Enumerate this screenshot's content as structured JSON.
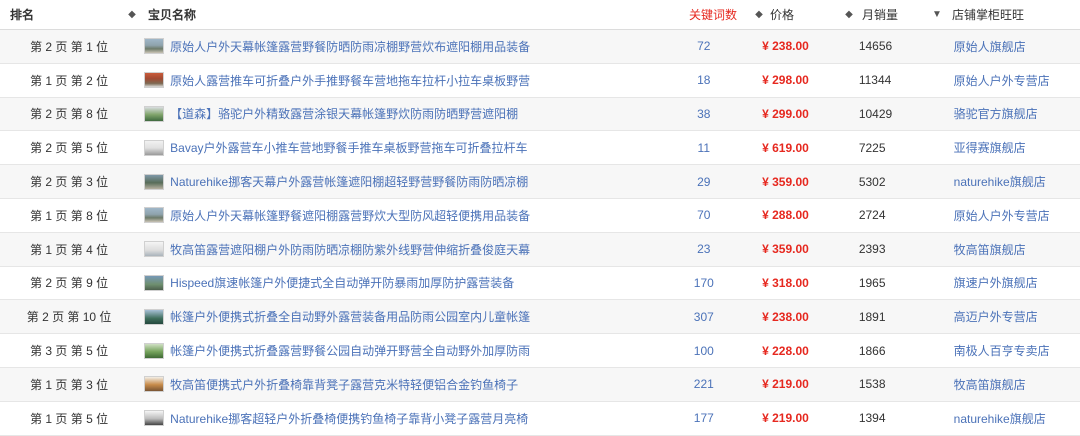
{
  "colors": {
    "keyword_header": "#e6281f",
    "price": "#e6281f",
    "link": "#4b72b8",
    "alt_row": "#f7f7f7"
  },
  "header": {
    "rank": "排名",
    "title": "宝贝名称",
    "keywords": "关键词数",
    "price": "价格",
    "sales": "月销量",
    "shop": "店铺掌柜旺旺",
    "sort_icon": "◆",
    "sort_desc_icon": "▼"
  },
  "rows": [
    {
      "rank": "第 2 页 第 1 位",
      "title": "原始人户外天幕帐篷露营野餐防晒防雨凉棚野营炊布遮阳棚用品装备",
      "keywords": "72",
      "price": "¥ 238.00",
      "sales": "14656",
      "shop": "原始人旗舰店"
    },
    {
      "rank": "第 1 页 第 2 位",
      "title": "原始人露营推车可折叠户外手推野餐车营地拖车拉杆小拉车桌板野营",
      "keywords": "18",
      "price": "¥ 298.00",
      "sales": "11344",
      "shop": "原始人户外专营店"
    },
    {
      "rank": "第 2 页 第 8 位",
      "title": "【道森】骆驼户外精致露营涂银天幕帐篷野炊防雨防晒野营遮阳棚",
      "keywords": "38",
      "price": "¥ 299.00",
      "sales": "10429",
      "shop": "骆驼官方旗舰店"
    },
    {
      "rank": "第 2 页 第 5 位",
      "title": "Bavay户外露营车小推车营地野餐手推车桌板野营拖车可折叠拉杆车",
      "keywords": "11",
      "price": "¥ 619.00",
      "sales": "7225",
      "shop": "亚得赛旗舰店"
    },
    {
      "rank": "第 2 页 第 3 位",
      "title": "Naturehike挪客天幕户外露营帐篷遮阳棚超轻野营野餐防雨防晒凉棚",
      "keywords": "29",
      "price": "¥ 359.00",
      "sales": "5302",
      "shop": "naturehike旗舰店"
    },
    {
      "rank": "第 1 页 第 8 位",
      "title": "原始人户外天幕帐篷野餐遮阳棚露营野炊大型防风超轻便携用品装备",
      "keywords": "70",
      "price": "¥ 288.00",
      "sales": "2724",
      "shop": "原始人户外专营店"
    },
    {
      "rank": "第 1 页 第 4 位",
      "title": "牧高笛露营遮阳棚户外防雨防晒凉棚防紫外线野营伸缩折叠俊庭天幕",
      "keywords": "23",
      "price": "¥ 359.00",
      "sales": "2393",
      "shop": "牧高笛旗舰店"
    },
    {
      "rank": "第 2 页 第 9 位",
      "title": "Hispeed旗速帐篷户外便捷式全自动弹开防暴雨加厚防护露营装备",
      "keywords": "170",
      "price": "¥ 318.00",
      "sales": "1965",
      "shop": "旗速户外旗舰店"
    },
    {
      "rank": "第 2 页 第 10 位",
      "title": "帐篷户外便携式折叠全自动野外露营装备用品防雨公园室内儿童帐篷",
      "keywords": "307",
      "price": "¥ 238.00",
      "sales": "1891",
      "shop": "高迈户外专营店"
    },
    {
      "rank": "第 3 页 第 5 位",
      "title": "帐篷户外便携式折叠露营野餐公园自动弹开野营全自动野外加厚防雨",
      "keywords": "100",
      "price": "¥ 228.00",
      "sales": "1866",
      "shop": "南极人百亨专卖店"
    },
    {
      "rank": "第 1 页 第 3 位",
      "title": "牧高笛便携式户外折叠椅靠背凳子露营克米特轻便铝合金钓鱼椅子",
      "keywords": "221",
      "price": "¥ 219.00",
      "sales": "1538",
      "shop": "牧高笛旗舰店"
    },
    {
      "rank": "第 1 页 第 5 位",
      "title": "Naturehike挪客超轻户外折叠椅便携钓鱼椅子靠背小凳子露营月亮椅",
      "keywords": "177",
      "price": "¥ 219.00",
      "sales": "1394",
      "shop": "naturehike旗舰店"
    }
  ]
}
